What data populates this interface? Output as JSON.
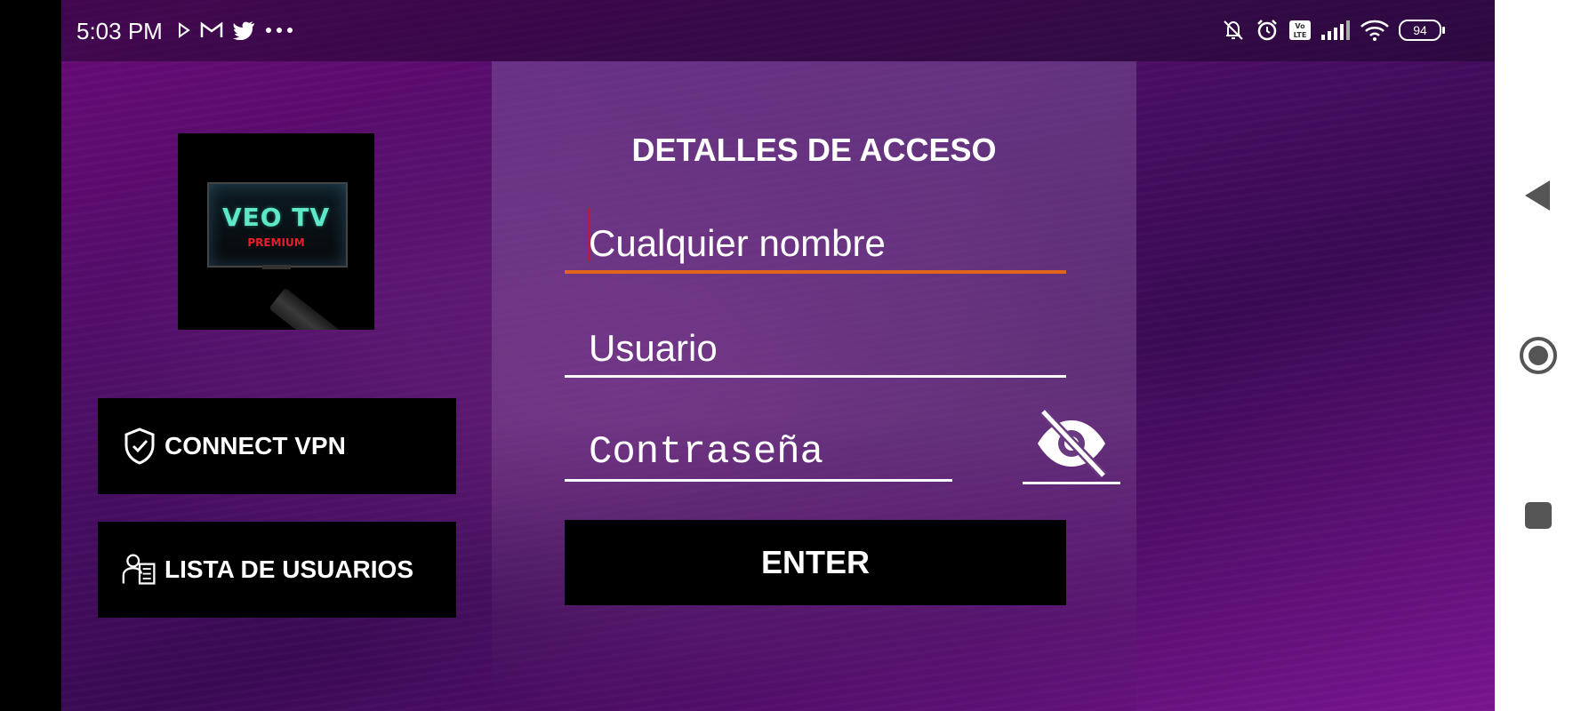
{
  "status_bar": {
    "time": "5:03 PM",
    "left_icons": [
      "play-store-icon",
      "gmail-icon",
      "twitter-icon",
      "more-dots-icon"
    ],
    "right_icons": [
      "muted-bell-icon",
      "alarm-icon",
      "volte-icon",
      "signal-icon",
      "wifi-icon"
    ],
    "battery_level": "94"
  },
  "logo": {
    "title": "VEO TV",
    "subtitle": "PREMIUM"
  },
  "side_buttons": {
    "vpn_label": "CONNECT VPN",
    "users_label": "LISTA DE USUARIOS"
  },
  "login": {
    "title": "DETALLES DE ACCESO",
    "name_placeholder": "Cualquier nombre",
    "user_placeholder": "Usuario",
    "password_placeholder": "Contraseña",
    "enter_label": "ENTER"
  },
  "navigation": {
    "buttons": [
      "back-icon",
      "home-icon",
      "recents-icon"
    ]
  },
  "colors": {
    "accent_underline": "#e0641c",
    "caret": "#d0103a",
    "logo_title": "#5fe8c8",
    "logo_subtitle": "#e8202a"
  }
}
